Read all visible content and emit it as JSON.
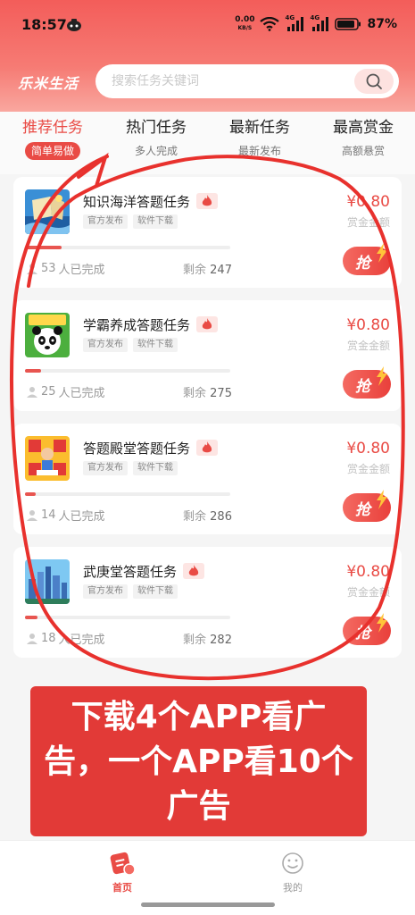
{
  "status_bar": {
    "time": "18:57",
    "net_speed": "0.00",
    "net_unit": "KB/S",
    "network_1": "4G",
    "network_2": "4G",
    "battery": "87%"
  },
  "header": {
    "brand": "乐米生活",
    "search_placeholder": "搜索任务关键词"
  },
  "tabs": [
    {
      "title": "推荐任务",
      "subtitle": "简单易做",
      "active": true
    },
    {
      "title": "热门任务",
      "subtitle": "多人完成",
      "active": false
    },
    {
      "title": "最新任务",
      "subtitle": "最新发布",
      "active": false
    },
    {
      "title": "最高赏金",
      "subtitle": "高额悬赏",
      "active": false
    }
  ],
  "tasks": [
    {
      "title": "知识海洋答题任务",
      "tags": [
        "官方发布",
        "软件下载"
      ],
      "completed": "53",
      "completed_suffix": "人已完成",
      "remaining_label": "剩余",
      "remaining": "247",
      "progress": 0.18,
      "reward": "¥0.80",
      "reward_label": "赏金金额",
      "grab": "抢"
    },
    {
      "title": "学霸养成答题任务",
      "tags": [
        "官方发布",
        "软件下载"
      ],
      "completed": "25",
      "completed_suffix": "人已完成",
      "remaining_label": "剩余",
      "remaining": "275",
      "progress": 0.08,
      "reward": "¥0.80",
      "reward_label": "赏金金额",
      "grab": "抢"
    },
    {
      "title": "答题殿堂答题任务",
      "tags": [
        "官方发布",
        "软件下载"
      ],
      "completed": "14",
      "completed_suffix": "人已完成",
      "remaining_label": "剩余",
      "remaining": "286",
      "progress": 0.05,
      "reward": "¥0.80",
      "reward_label": "赏金金额",
      "grab": "抢"
    },
    {
      "title": "武庚堂答题任务",
      "tags": [
        "官方发布",
        "软件下载"
      ],
      "completed": "18",
      "completed_suffix": "人已完成",
      "remaining_label": "剩余",
      "remaining": "282",
      "progress": 0.06,
      "reward": "¥0.80",
      "reward_label": "赏金金额",
      "grab": "抢"
    }
  ],
  "overlay_text": "下载4个APP看广告，一个APP看10个广告",
  "bottom_nav": [
    {
      "label": "首页",
      "icon": "home-task-icon",
      "active": true
    },
    {
      "label": "我的",
      "icon": "smiley-icon",
      "active": false
    }
  ],
  "colors": {
    "accent": "#e94b45",
    "header": "#f35d5a",
    "banner": "#e23a37",
    "annotation": "#e8312d"
  }
}
